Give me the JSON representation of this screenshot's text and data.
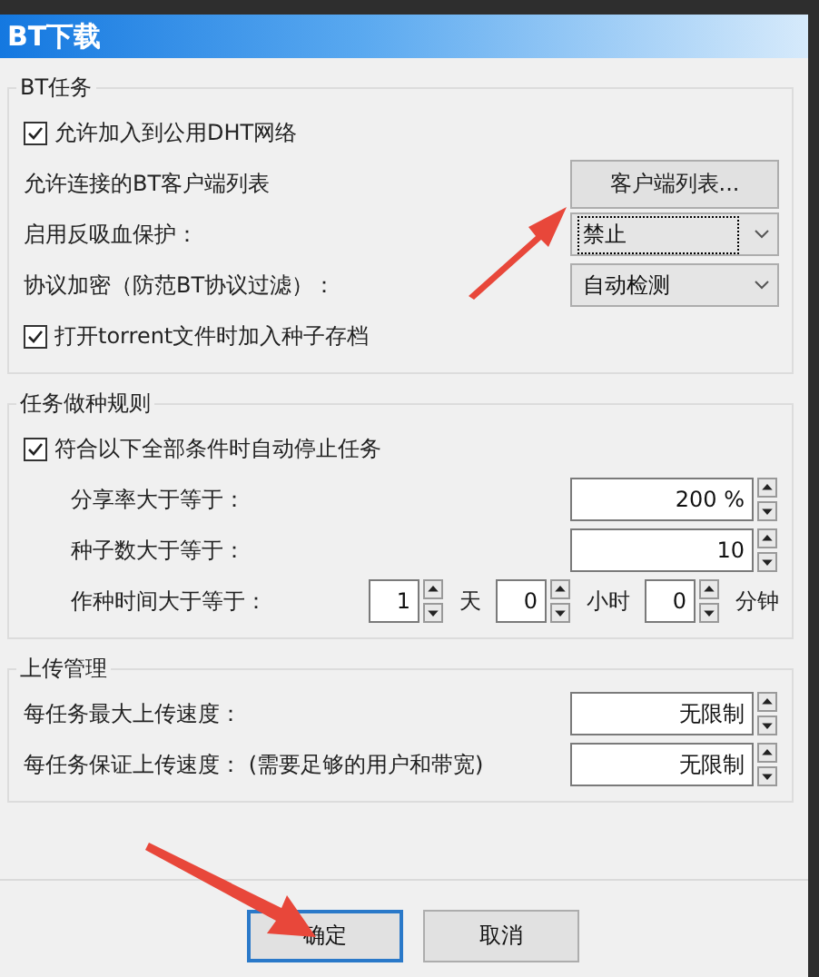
{
  "window": {
    "title": "BT下载"
  },
  "groups": [
    {
      "title": "BT任务",
      "rows": [
        {
          "kind": "checkbox",
          "label": "允许加入到公用DHT网络",
          "checked": true
        },
        {
          "kind": "button",
          "label": "允许连接的BT客户端列表",
          "button": "客户端列表..."
        },
        {
          "kind": "select",
          "label": "启用反吸血保护：",
          "value": "禁止",
          "focused": true
        },
        {
          "kind": "select",
          "label": "协议加密（防范BT协议过滤）：",
          "value": "自动检测",
          "focused": false
        },
        {
          "kind": "checkbox",
          "label": "打开torrent文件时加入种子存档",
          "checked": true
        }
      ]
    },
    {
      "title": "任务做种规则",
      "rows": [
        {
          "kind": "checkbox",
          "label": "符合以下全部条件时自动停止任务",
          "checked": true,
          "children": [
            {
              "kind": "spin",
              "label": "分享率大于等于：",
              "value": "200 %"
            },
            {
              "kind": "spin",
              "label": "种子数大于等于：",
              "value": "10"
            },
            {
              "kind": "spins",
              "label": "作种时间大于等于：",
              "fields": [
                {
                  "value": "1",
                  "unit": "天"
                },
                {
                  "value": "0",
                  "unit": "小时"
                },
                {
                  "value": "0",
                  "unit": "分钟"
                }
              ]
            }
          ]
        }
      ]
    },
    {
      "title": "上传管理",
      "rows": [
        {
          "kind": "spin",
          "label": "每任务最大上传速度：",
          "value": "无限制"
        },
        {
          "kind": "spin",
          "label": "每任务保证上传速度： (需要足够的用户和带宽)",
          "value": "无限制"
        }
      ]
    }
  ],
  "buttons": [
    {
      "label": "确定",
      "default": true
    },
    {
      "label": "取消",
      "default": false
    }
  ]
}
